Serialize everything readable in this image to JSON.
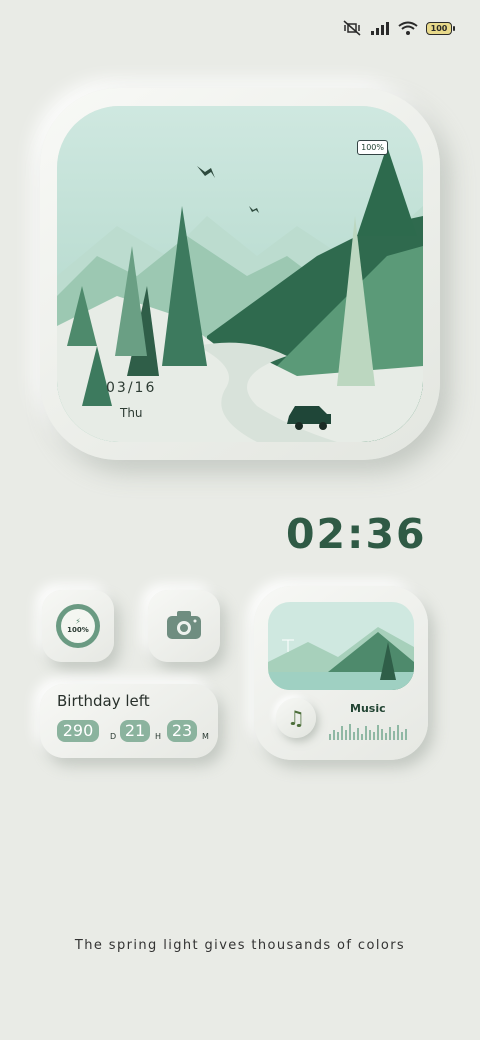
{
  "status_bar": {
    "icons": [
      "mute-vibrate-icon",
      "signal-icon",
      "wifi-icon",
      "battery-icon"
    ],
    "battery_level": "100"
  },
  "scene_widget": {
    "battery_label": "100%",
    "date": "03/16",
    "day": "Thu"
  },
  "clock": {
    "time": "02:36"
  },
  "battery_widget": {
    "percent": "100%",
    "icon": "bolt-icon"
  },
  "camera_widget": {
    "icon": "camera-icon"
  },
  "birthday_widget": {
    "title": "Birthday left",
    "days": "290",
    "days_unit": "D",
    "hours": "21",
    "hours_unit": "H",
    "minutes": "23",
    "minutes_unit": "M"
  },
  "music_widget": {
    "label": "Music",
    "icon": "music-note-icon"
  },
  "slogan": "The spring light gives thousands of colors",
  "colors": {
    "background": "#e9ebe6",
    "accent": "#2f5a45",
    "pill": "#8bb39e"
  }
}
